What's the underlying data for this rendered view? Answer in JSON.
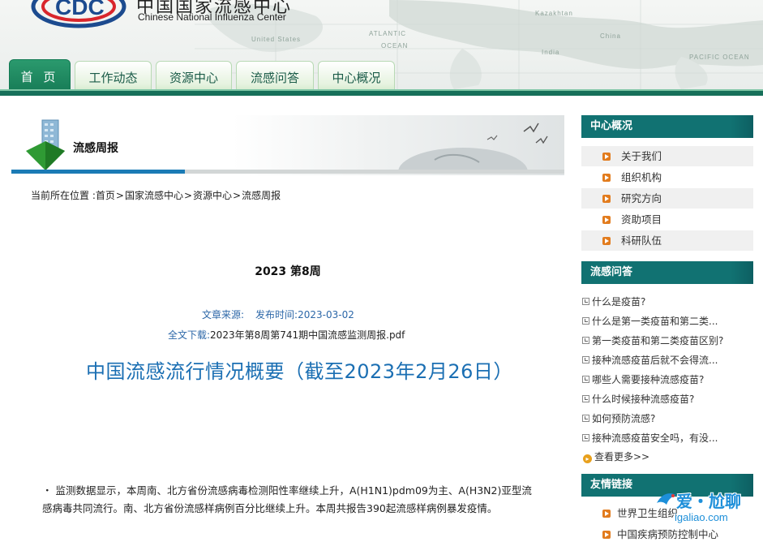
{
  "header": {
    "site_name_cn": "中国国家流感中心",
    "site_name_en": "Chinese National Influenza Center",
    "map_labels": [
      "United States",
      "ATLANTIC",
      "OCEAN",
      "Kazakhtan",
      "China",
      "India",
      "PACIFIC OCEAN"
    ]
  },
  "nav": {
    "tabs": [
      {
        "label": "首 页",
        "active": true
      },
      {
        "label": "工作动态"
      },
      {
        "label": "资源中心"
      },
      {
        "label": "流感问答"
      },
      {
        "label": "中心概况"
      }
    ]
  },
  "banner": {
    "title": "流感周报"
  },
  "breadcrumb": {
    "prefix": "当前所在位置 :",
    "items": [
      "首页",
      "国家流感中心",
      "资源中心",
      "流感周报"
    ],
    "separator": ">"
  },
  "article": {
    "week_title": "2023 第8周",
    "source_label": "文章来源:",
    "publish_label": "发布时间:",
    "publish_date": "2023-03-02",
    "download_label": "全文下载:",
    "download_file": "2023年第8周第741期中国流感监测周报.pdf",
    "headline": "中国流感流行情况概要（截至2023年2月26日）",
    "body": "・ 监测数据显示，本周南、北方省份流感病毒检测阳性率继续上升，A(H1N1)pdm09为主、A(H3N2)亚型流感病毒共同流行。南、北方省份流感样病例百分比继续上升。本周共报告390起流感样病例暴发疫情。"
  },
  "sidebar": {
    "about": {
      "title": "中心概况",
      "items": [
        "关于我们",
        "组织机构",
        "研究方向",
        "资助项目",
        "科研队伍"
      ]
    },
    "faq": {
      "title": "流感问答",
      "items": [
        "什么是疫苗?",
        "什么是第一类疫苗和第二类...",
        "第一类疫苗和第二类疫苗区别?",
        "接种流感疫苗后就不会得流...",
        "哪些人需要接种流感疫苗?",
        "什么时候接种流感疫苗?",
        "如何预防流感?",
        "接种流感疫苗安全吗，有没..."
      ],
      "more_label": "查看更多>>"
    },
    "links": {
      "title": "友情链接",
      "items": [
        "世界卫生组织",
        "中国疾病预防控制中心"
      ]
    }
  },
  "watermark": {
    "text": "爱・尬聊",
    "url": "igaliao.com"
  },
  "colors": {
    "accent_green": "#17705a",
    "sidebar_teal": "#117272",
    "link_blue": "#1b6fb3",
    "arrow_orange": "#e27c1e"
  }
}
